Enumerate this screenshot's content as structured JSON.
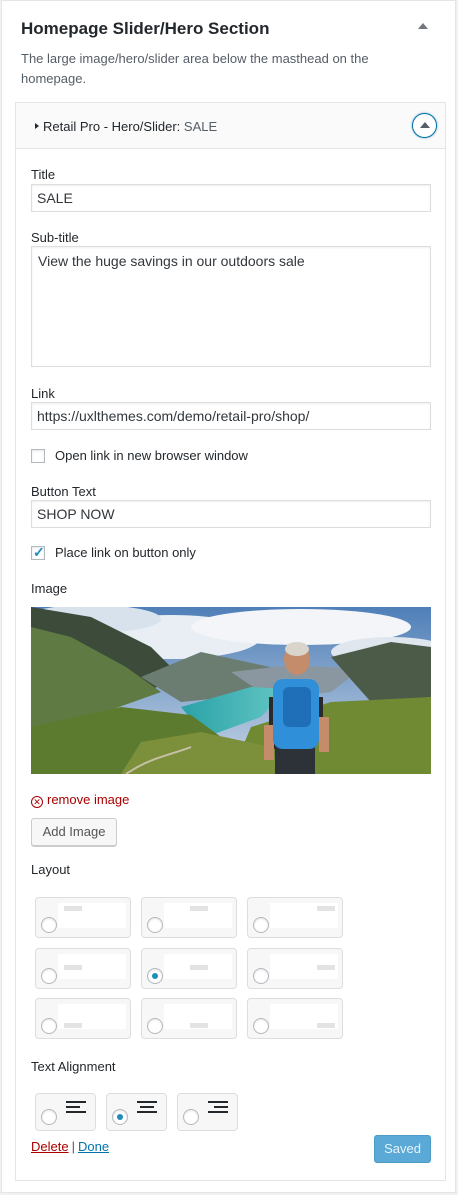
{
  "section": {
    "title": "Homepage Slider/Hero Section",
    "description": "The large image/hero/slider area below the masthead on the homepage."
  },
  "widget": {
    "name": "Retail Pro - Hero/Slider:",
    "in_title": "SALE"
  },
  "fields": {
    "title_label": "Title",
    "title_value": "SALE",
    "subtitle_label": "Sub-title",
    "subtitle_value": "View the huge savings in our outdoors sale",
    "link_label": "Link",
    "link_value": "https://uxlthemes.com/demo/retail-pro/shop/",
    "new_window_label": "Open link in new browser window",
    "new_window_checked": false,
    "button_text_label": "Button Text",
    "button_text_value": "SHOP NOW",
    "link_button_only_label": "Place link on button only",
    "link_button_only_checked": true,
    "image_label": "Image"
  },
  "image": {
    "remove_label": "remove image",
    "add_label": "Add Image"
  },
  "layout": {
    "label": "Layout",
    "selected_index": 4,
    "options_count": 9
  },
  "alignment": {
    "label": "Text Alignment",
    "options": [
      "left",
      "center",
      "right"
    ],
    "selected": "center"
  },
  "actions": {
    "delete_label": "Delete",
    "separator": "|",
    "done_label": "Done",
    "saved_label": "Saved"
  },
  "colors": {
    "link_blue": "#0073aa",
    "delete_red": "#aa0000",
    "primary_button": "#5aa9d6"
  }
}
